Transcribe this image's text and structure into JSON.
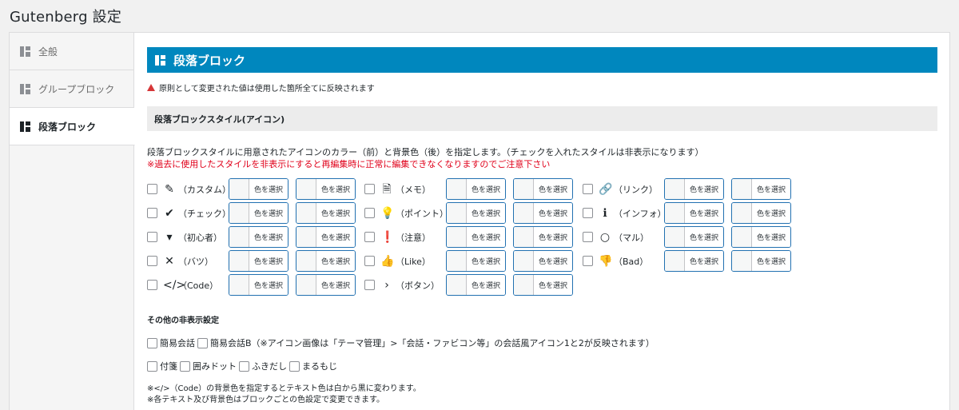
{
  "page_title": "Gutenberg 設定",
  "sidebar": {
    "items": [
      {
        "label": "全般"
      },
      {
        "label": "グループブロック"
      },
      {
        "label": "段落ブロック"
      }
    ]
  },
  "section": {
    "title": "段落ブロック",
    "notice": "原則として変更された値は使用した箇所全てに反映されます",
    "subtitle": "段落ブロックスタイル(アイコン)",
    "description": "段落ブロックスタイルに用意されたアイコンのカラー（前）と背景色（後）を指定します。（チェックを入れたスタイルは非表示になります）",
    "warning": "※過去に使用したスタイルを非表示にすると再編集時に正常に編集できなくなりますのでご注意下さい",
    "color_button_label": "色を選択",
    "accent_color": "#0087be",
    "warning_color": "#e0001a"
  },
  "styles": [
    {
      "label": "（カスタム）",
      "icon": "pencil-icon",
      "glyph": "✎"
    },
    {
      "label": "（メモ）",
      "icon": "memo-icon",
      "glyph": "🗎"
    },
    {
      "label": "（リンク）",
      "icon": "link-icon",
      "glyph": "🔗"
    },
    {
      "label": "（チェック）",
      "icon": "check-icon",
      "glyph": "✔"
    },
    {
      "label": "（ポイント）",
      "icon": "lightbulb-icon",
      "glyph": "💡"
    },
    {
      "label": "（インフォ）",
      "icon": "info-icon",
      "glyph": "ℹ"
    },
    {
      "label": "（初心者）",
      "icon": "beginner-icon",
      "glyph": "▾"
    },
    {
      "label": "（注意）",
      "icon": "exclamation-icon",
      "glyph": "❗"
    },
    {
      "label": "（マル）",
      "icon": "circle-icon",
      "glyph": "○"
    },
    {
      "label": "（バツ）",
      "icon": "cross-icon",
      "glyph": "✕"
    },
    {
      "label": "（Like）",
      "icon": "thumbs-up-icon",
      "glyph": "👍"
    },
    {
      "label": "（Bad）",
      "icon": "thumbs-down-icon",
      "glyph": "👎"
    },
    {
      "label": "（Code）",
      "icon": "code-icon",
      "glyph": "</>"
    },
    {
      "label": "（ボタン）",
      "icon": "chevron-right-icon",
      "glyph": "›"
    }
  ],
  "other": {
    "title": "その他の非表示設定",
    "row1": [
      "簡易会話",
      "簡易会話B（※アイコン画像は「テーマ管理」>「会話・ファビコン等」の会話風アイコン1と2が反映されます）"
    ],
    "row2": [
      "付箋",
      "囲みドット",
      "ふきだし",
      "まるもじ"
    ],
    "notes": [
      "※</>（Code）の背景色を指定するとテキスト色は白から黒に変わります。",
      "※各テキスト及び背景色はブロックごとの色設定で変更できます。"
    ]
  }
}
